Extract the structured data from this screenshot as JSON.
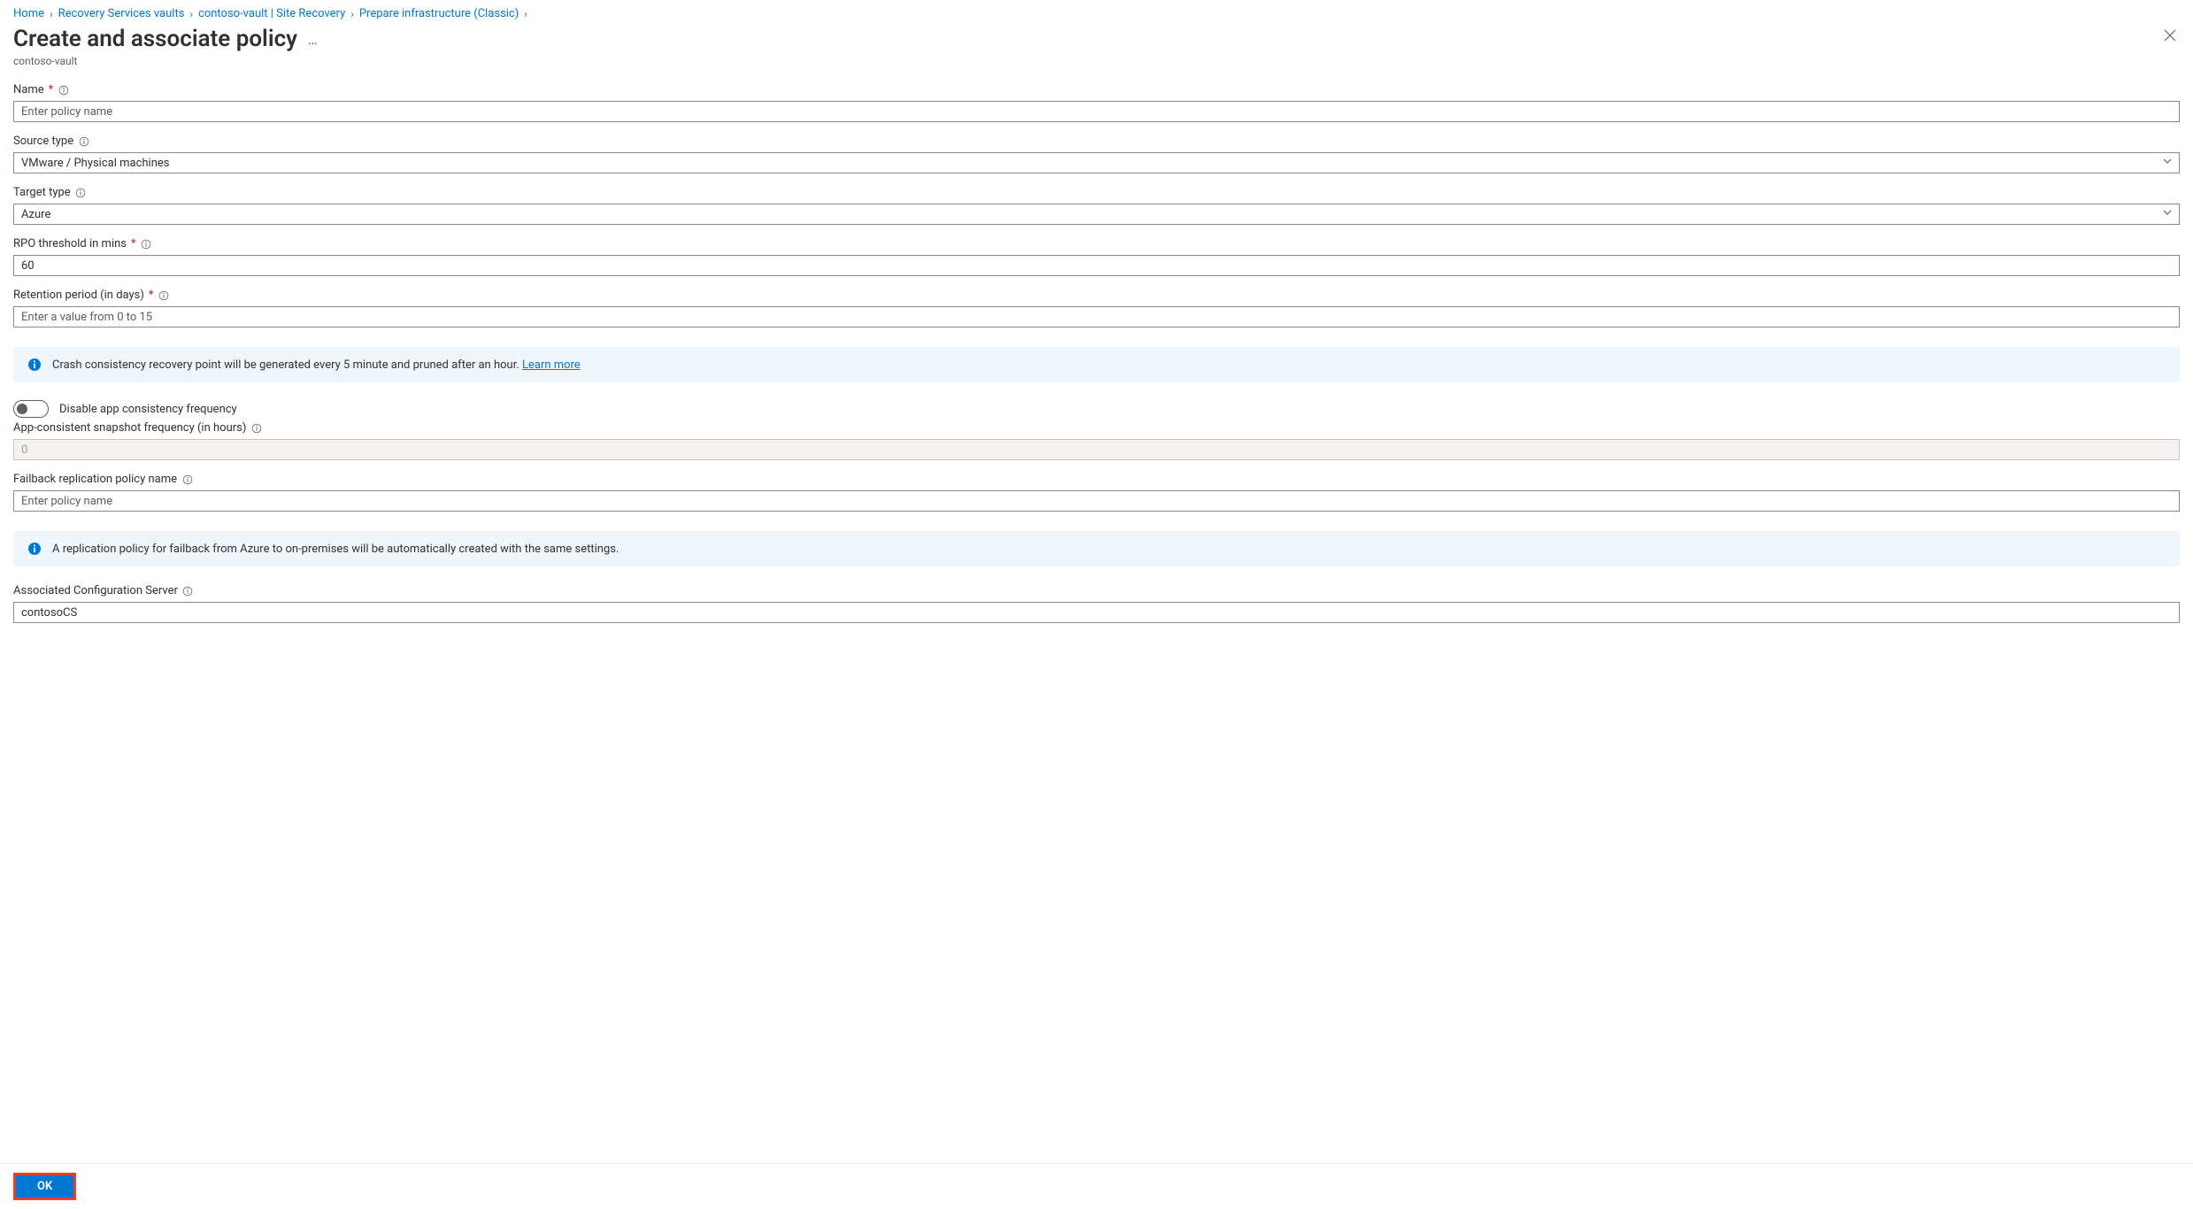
{
  "breadcrumb": {
    "items": [
      {
        "label": "Home"
      },
      {
        "label": "Recovery Services vaults"
      },
      {
        "label": "contoso-vault | Site Recovery"
      },
      {
        "label": "Prepare infrastructure (Classic)"
      }
    ]
  },
  "header": {
    "title": "Create and associate policy",
    "subtitle": "contoso-vault"
  },
  "fields": {
    "name": {
      "label": "Name",
      "placeholder": "Enter policy name",
      "value": ""
    },
    "source_type": {
      "label": "Source type",
      "value": "VMware / Physical machines"
    },
    "target_type": {
      "label": "Target type",
      "value": "Azure"
    },
    "rpo_threshold": {
      "label": "RPO threshold in mins",
      "value": "60"
    },
    "retention": {
      "label": "Retention period (in days)",
      "placeholder": "Enter a value from 0 to 15",
      "value": ""
    },
    "crash_banner": "Crash consistency recovery point will be generated every 5 minute and pruned after an hour.",
    "crash_learn": "Learn more",
    "toggle_label": "Disable app consistency frequency",
    "app_consistent": {
      "label": "App-consistent snapshot frequency (in hours)",
      "value": "0"
    },
    "failback_policy": {
      "label": "Failback replication policy name",
      "placeholder": "Enter policy name",
      "value": ""
    },
    "failback_banner": "A replication policy for failback from Azure to on-premises will be automatically created with the same settings.",
    "config_server": {
      "label": "Associated Configuration Server",
      "value": "contosoCS"
    }
  },
  "footer": {
    "ok": "OK"
  }
}
